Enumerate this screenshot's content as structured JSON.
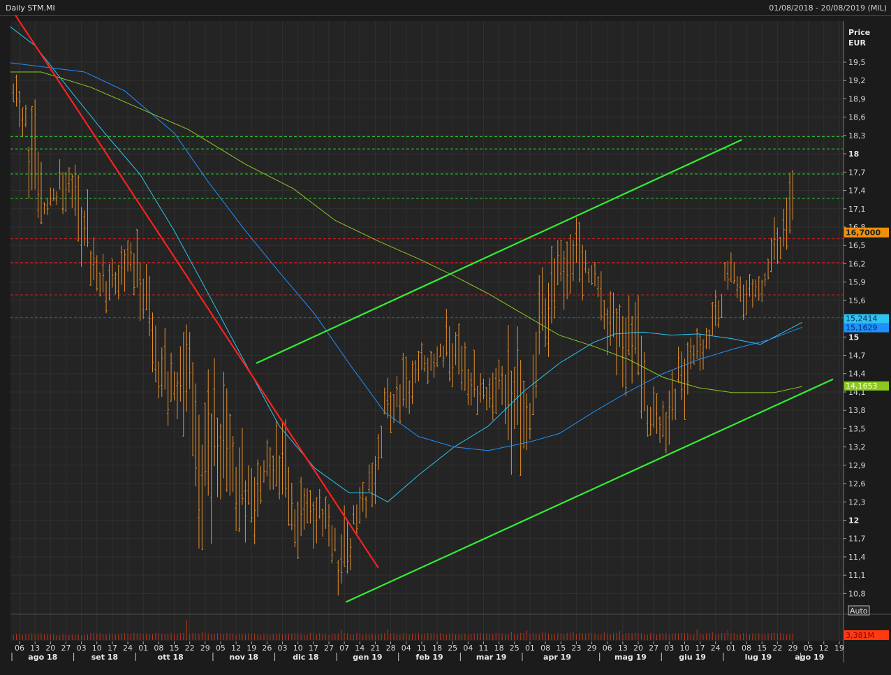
{
  "header": {
    "title": "Daily STM.MI",
    "range": "01/08/2018 - 20/08/2019 (MIL)"
  },
  "axis": {
    "price_label": "Price",
    "currency_label": "EUR",
    "auto_label": "Auto",
    "volume_last": "3,381M"
  },
  "chart_data": {
    "type": "ohlc",
    "title": "Daily STM.MI",
    "x_unit": "weeks from 06/08/2018",
    "ylabel": "Price EUR",
    "ylim": [
      10.6,
      20.1
    ],
    "y_ticks": [
      "19,5",
      "19,2",
      "18,9",
      "18,6",
      "18,3",
      "18",
      "17,7",
      "17,4",
      "17,1",
      "16,8",
      "16,5",
      "16,2",
      "15,9",
      "15,6",
      "15,3",
      "15",
      "14,7",
      "14,4",
      "14,1",
      "13,8",
      "13,5",
      "13,2",
      "12,9",
      "12,6",
      "12,3",
      "12",
      "11,7",
      "11,4",
      "11,1",
      "10,8"
    ],
    "y_tick_values": [
      19.5,
      19.2,
      18.9,
      18.6,
      18.3,
      18,
      17.7,
      17.4,
      17.1,
      16.8,
      16.5,
      16.2,
      15.9,
      15.6,
      15.3,
      15,
      14.7,
      14.4,
      14.1,
      13.8,
      13.5,
      13.2,
      12.9,
      12.6,
      12.3,
      12,
      11.7,
      11.4,
      11.1,
      10.8
    ],
    "x_ticks": [
      "06",
      "13",
      "20",
      "27",
      "03",
      "10",
      "17",
      "24",
      "01",
      "08",
      "15",
      "22",
      "29",
      "05",
      "12",
      "19",
      "26",
      "03",
      "10",
      "17",
      "27",
      "07",
      "14",
      "21",
      "28",
      "04",
      "11",
      "18",
      "25",
      "04",
      "11",
      "18",
      "25",
      "01",
      "08",
      "15",
      "23",
      "29",
      "06",
      "13",
      "20",
      "27",
      "03",
      "10",
      "17",
      "24",
      "01",
      "08",
      "15",
      "22",
      "29",
      "05",
      "12",
      "19"
    ],
    "months": [
      {
        "label": "ago 18",
        "week": 0
      },
      {
        "label": "set 18",
        "week": 4
      },
      {
        "label": "ott 18",
        "week": 8
      },
      {
        "label": "nov 18",
        "week": 13
      },
      {
        "label": "dic 18",
        "week": 17
      },
      {
        "label": "gen 19",
        "week": 21
      },
      {
        "label": "feb 19",
        "week": 25
      },
      {
        "label": "mar 19",
        "week": 29
      },
      {
        "label": "apr 19",
        "week": 33
      },
      {
        "label": "mag 19",
        "week": 38
      },
      {
        "label": "giu 19",
        "week": 42
      },
      {
        "label": "lug 19",
        "week": 46
      },
      {
        "label": "ago 19",
        "week": 51
      }
    ],
    "weekly_high_low": [
      [
        19.3,
        18.7
      ],
      [
        18.8,
        17.3
      ],
      [
        17.3,
        17.0
      ],
      [
        17.9,
        17.2
      ],
      [
        17.7,
        16.6
      ],
      [
        16.5,
        15.8
      ],
      [
        16.1,
        15.5
      ],
      [
        16.6,
        15.9
      ],
      [
        16.6,
        15.6
      ],
      [
        15.2,
        14.2
      ],
      [
        14.5,
        13.6
      ],
      [
        15.5,
        13.8
      ],
      [
        13.9,
        11.7
      ],
      [
        14.3,
        12.5
      ],
      [
        13.5,
        12.1
      ],
      [
        12.8,
        11.7
      ],
      [
        13.1,
        12.4
      ],
      [
        13.8,
        12.5
      ],
      [
        12.5,
        11.5
      ],
      [
        12.5,
        11.7
      ],
      [
        12.4,
        11.7
      ],
      [
        11.8,
        10.8
      ],
      [
        12.4,
        11.8
      ],
      [
        12.9,
        12.1
      ],
      [
        14.2,
        13.5
      ],
      [
        14.5,
        13.6
      ],
      [
        14.8,
        14.3
      ],
      [
        14.8,
        14.4
      ],
      [
        15.3,
        14.4
      ],
      [
        14.8,
        14.0
      ],
      [
        14.3,
        13.8
      ],
      [
        14.6,
        13.8
      ],
      [
        15.1,
        13.2
      ],
      [
        14.0,
        12.9
      ],
      [
        15.9,
        14.6
      ],
      [
        16.5,
        15.5
      ],
      [
        16.9,
        15.9
      ],
      [
        16.4,
        16.0
      ],
      [
        15.9,
        15.0
      ],
      [
        15.5,
        14.2
      ],
      [
        15.8,
        14.4
      ],
      [
        14.1,
        13.4
      ],
      [
        14.0,
        13.1
      ],
      [
        14.8,
        13.8
      ],
      [
        15.0,
        14.4
      ],
      [
        15.4,
        14.8
      ],
      [
        16.4,
        15.9
      ],
      [
        16.0,
        15.4
      ],
      [
        15.9,
        15.5
      ],
      [
        16.7,
        16.0
      ],
      [
        17.6,
        16.6
      ]
    ],
    "last_price": {
      "value": 16.7,
      "label": "16,7000",
      "color": "#f0900a"
    },
    "moving_averages": [
      {
        "name": "MA fast",
        "color": "#2ec4f0",
        "label": "15,2414",
        "value": 15.2414,
        "points": [
          [
            -0.6,
            20.08
          ],
          [
            1.0,
            19.77
          ],
          [
            3.3,
            19.03
          ],
          [
            5.5,
            18.34
          ],
          [
            7.8,
            17.66
          ],
          [
            10.0,
            16.74
          ],
          [
            12.2,
            15.71
          ],
          [
            14.6,
            14.57
          ],
          [
            16.8,
            13.54
          ],
          [
            19.1,
            12.85
          ],
          [
            21.3,
            12.45
          ],
          [
            22.7,
            12.45
          ],
          [
            23.8,
            12.3
          ],
          [
            25.8,
            12.74
          ],
          [
            28.1,
            13.2
          ],
          [
            30.3,
            13.54
          ],
          [
            32.6,
            14.11
          ],
          [
            34.9,
            14.57
          ],
          [
            37.1,
            14.91
          ],
          [
            38.5,
            15.05
          ],
          [
            40.3,
            15.08
          ],
          [
            42.1,
            15.03
          ],
          [
            43.9,
            15.05
          ],
          [
            46.1,
            14.97
          ],
          [
            47.9,
            14.88
          ],
          [
            50.6,
            15.24
          ]
        ]
      },
      {
        "name": "MA medium",
        "color": "#1e90ff",
        "label": "15,1629",
        "value": 15.1629,
        "points": [
          [
            -0.6,
            19.49
          ],
          [
            4.2,
            19.34
          ],
          [
            6.8,
            19.03
          ],
          [
            10.0,
            18.34
          ],
          [
            12.2,
            17.54
          ],
          [
            14.6,
            16.74
          ],
          [
            16.8,
            16.06
          ],
          [
            19.1,
            15.37
          ],
          [
            21.3,
            14.57
          ],
          [
            23.6,
            13.77
          ],
          [
            25.8,
            13.37
          ],
          [
            28.1,
            13.2
          ],
          [
            30.3,
            13.14
          ],
          [
            33.1,
            13.29
          ],
          [
            34.9,
            13.42
          ],
          [
            37.1,
            13.77
          ],
          [
            39.4,
            14.11
          ],
          [
            41.6,
            14.4
          ],
          [
            43.9,
            14.63
          ],
          [
            46.1,
            14.8
          ],
          [
            48.4,
            14.95
          ],
          [
            50.6,
            15.16
          ]
        ]
      },
      {
        "name": "MA slow",
        "color": "#8cc820",
        "label": "14,1653",
        "value": 14.1653,
        "points": [
          [
            -0.6,
            19.34
          ],
          [
            1.4,
            19.34
          ],
          [
            4.6,
            19.09
          ],
          [
            7.8,
            18.74
          ],
          [
            10.9,
            18.4
          ],
          [
            14.6,
            17.83
          ],
          [
            17.7,
            17.43
          ],
          [
            20.4,
            16.91
          ],
          [
            23.2,
            16.57
          ],
          [
            25.8,
            16.28
          ],
          [
            28.1,
            16.0
          ],
          [
            30.3,
            15.71
          ],
          [
            32.6,
            15.37
          ],
          [
            34.9,
            15.03
          ],
          [
            37.1,
            14.85
          ],
          [
            39.4,
            14.63
          ],
          [
            41.6,
            14.34
          ],
          [
            43.9,
            14.17
          ],
          [
            46.1,
            14.09
          ],
          [
            48.8,
            14.09
          ],
          [
            50.6,
            14.19
          ]
        ]
      }
    ],
    "trendlines": [
      {
        "name": "downtrend",
        "color": "#ff2020",
        "from": [
          -0.27,
          20.27
        ],
        "to": [
          23.2,
          11.22
        ]
      },
      {
        "name": "channel-upper",
        "color": "#33ee33",
        "from": [
          15.3,
          14.57
        ],
        "to": [
          46.7,
          18.23
        ]
      },
      {
        "name": "channel-lower",
        "color": "#33ee33",
        "from": [
          21.1,
          10.66
        ],
        "to": [
          52.6,
          14.31
        ]
      }
    ],
    "resistance_levels": [
      18.28,
      18.08,
      17.67,
      17.27
    ],
    "support_levels": [
      16.61,
      16.22,
      15.69,
      15.32
    ],
    "volume_weekly_M": [
      3.2,
      3.4,
      3.0,
      3.1,
      2.9,
      3.5,
      3.4,
      3.6,
      3.5,
      3.6,
      3.7,
      10.5,
      4.0,
      3.6,
      3.4,
      3.5,
      3.3,
      3.4,
      3.5,
      3.6,
      3.4,
      5.5,
      3.6,
      3.4,
      5.2,
      3.5,
      3.6,
      3.5,
      3.4,
      3.4,
      3.5,
      3.6,
      4.3,
      4.9,
      3.8,
      3.6,
      4.0,
      3.6,
      3.9,
      4.5,
      3.7,
      3.5,
      3.5,
      3.6,
      5.3,
      4.0,
      5.0,
      3.6,
      3.5,
      3.7,
      3.4
    ]
  }
}
